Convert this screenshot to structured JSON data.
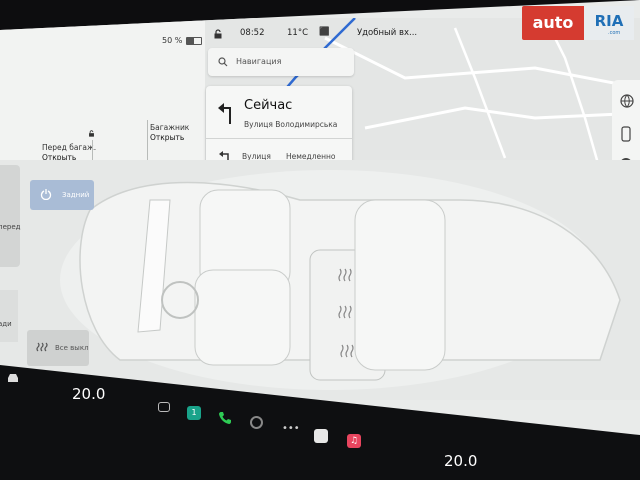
{
  "status": {
    "battery_percent": "50 %",
    "battery_level": 0.5,
    "time": "08:52",
    "temperature": "11°C",
    "location": "Удобный вх..."
  },
  "trunks": {
    "front_label": "Перед багаж.",
    "front_state": "Открыть",
    "rear_label": "Багажник",
    "rear_state": "Открыть"
  },
  "navigation": {
    "search_placeholder": "Навигация",
    "now_label": "Сейчас",
    "current_street": "Вулиця Володимирська",
    "next_street": "Вулиця",
    "next_when": "Немедленно"
  },
  "climate": {
    "rear_button": "Задний",
    "all_off_button": "Все выкл",
    "side_label_front": "перед",
    "side_label_rear": "ади"
  },
  "dock": {
    "driver_temp": "20.0",
    "passenger_temp": "20.0",
    "messages_badge": "1"
  },
  "watermark": {
    "auto": "auto",
    "ria": "RIA",
    "domain": ".com"
  },
  "colors": {
    "accent_blue": "#a9bcd6",
    "route_blue": "#2f6ad1",
    "watermark_red": "#d53b30"
  },
  "icons": [
    "lock-icon",
    "search-icon",
    "turn-left-arrow-icon",
    "turn-arrow-icon",
    "power-icon",
    "seat-heat-icon",
    "globe-icon",
    "phone-icon",
    "pin-icon",
    "car-icon",
    "camera-icon",
    "music-icon"
  ]
}
